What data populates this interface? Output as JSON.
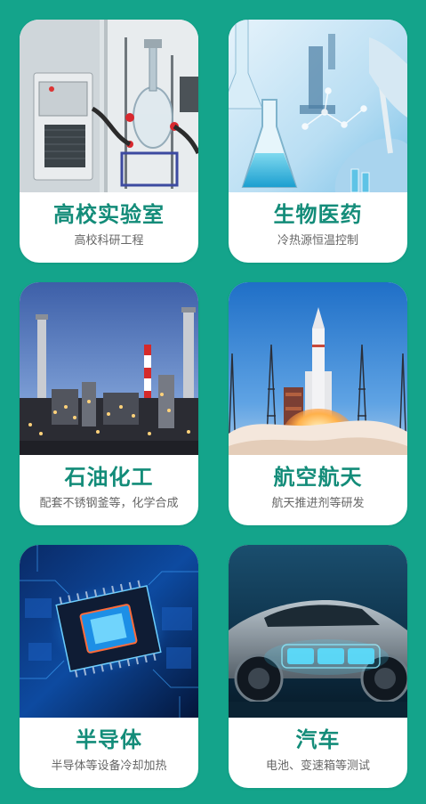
{
  "page": {
    "background_color": "#14a48b",
    "title_color": "#138c79",
    "subtitle_color": "#666666"
  },
  "cards": [
    {
      "title": "高校实验室",
      "subtitle": "高校科研工程",
      "image": "laboratory-reactor-photo"
    },
    {
      "title": "生物医药",
      "subtitle": "冷热源恒温控制",
      "image": "biotech-lab-photo"
    },
    {
      "title": "石油化工",
      "subtitle": "配套不锈钢釜等，化学合成",
      "image": "refinery-photo"
    },
    {
      "title": "航空航天",
      "subtitle": "航天推进剂等研发",
      "image": "rocket-launch-photo"
    },
    {
      "title": "半导体",
      "subtitle": "半导体等设备冷却加热",
      "image": "microchip-photo"
    },
    {
      "title": "汽车",
      "subtitle": "电池、变速箱等测试",
      "image": "electric-car-photo"
    }
  ]
}
